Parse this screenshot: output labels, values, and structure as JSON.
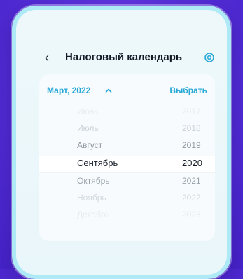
{
  "header": {
    "title": "Налоговый календарь"
  },
  "picker": {
    "current": "Март, 2022",
    "select_label": "Выбрать",
    "months": [
      "Июнь",
      "Июль",
      "Август",
      "Сентябрь",
      "Октябрь",
      "Ноябрь",
      "Декабрь"
    ],
    "years": [
      "2017",
      "2018",
      "2019",
      "2020",
      "2021",
      "2022",
      "2023"
    ],
    "selected_month": "Сентябрь",
    "selected_year": "2020"
  },
  "icons": {
    "back": "chevron-left-icon",
    "settings": "gear-icon",
    "caret": "chevron-up-icon"
  },
  "colors": {
    "accent": "#27a8d6",
    "background": "#5a31dc",
    "frame": "#aee9f6"
  }
}
